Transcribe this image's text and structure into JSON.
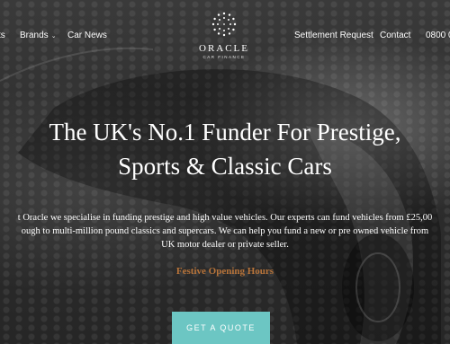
{
  "nav": {
    "left_items": [
      {
        "label": "ts"
      },
      {
        "label": "Brands",
        "has_dropdown": true
      },
      {
        "label": "Car News"
      }
    ],
    "right_items": [
      {
        "label": "Settlement Request"
      },
      {
        "label": "Contact"
      },
      {
        "label": "0800 0"
      }
    ]
  },
  "logo": {
    "brand": "ORACLE",
    "sub": "CAR FINANCE"
  },
  "hero": {
    "title_line1": "The UK's No.1 Funder For Prestige,",
    "title_line2": "Sports & Classic Cars",
    "text_line1": "t Oracle we specialise in funding prestige and high value vehicles. Our experts can fund vehicles from £25,00",
    "text_line2": "ough to multi-million pound classics and supercars. We can help you fund a new or pre owned vehicle from",
    "text_line3": "UK motor dealer or private seller.",
    "festive_link": "Festive Opening Hours",
    "cta_label": "GET A QUOTE"
  },
  "colors": {
    "accent": "#6cc6c3",
    "festive": "#b8743a"
  }
}
